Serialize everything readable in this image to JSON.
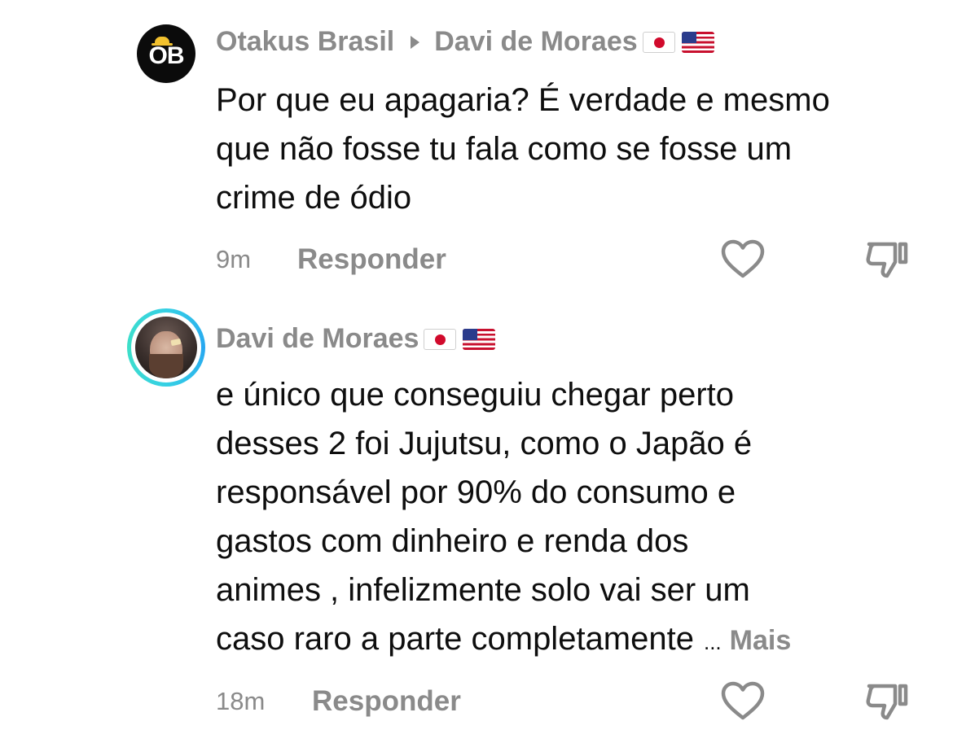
{
  "comments": [
    {
      "author": "Otakus Brasil",
      "reply_to": "Davi de Moraes",
      "text_lines": [
        "Por que eu apagaria? É verdade e mesmo",
        "que não fosse tu fala como se fosse um",
        "crime de ódio"
      ],
      "time": "9m",
      "reply_label": "Responder",
      "avatar_text": "OB"
    },
    {
      "author": "Davi de Moraes",
      "text_lines": [
        "e único que conseguiu chegar perto",
        "desses 2 foi Jujutsu, como o Japão é",
        "responsável por 90% do consumo e",
        "gastos com dinheiro e renda dos",
        "animes , infelizmente solo vai ser um",
        "caso raro a parte completamente"
      ],
      "ellipsis": "...",
      "more_label": "Mais",
      "time": "18m",
      "reply_label": "Responder"
    }
  ],
  "icons": {
    "flags": [
      "japan-flag-icon",
      "us-flag-icon"
    ],
    "actions": [
      "heart-icon",
      "dislike-icon"
    ]
  },
  "colors": {
    "secondary_text": "#8a8a8a",
    "primary_text": "#0e0e0e",
    "story_ring": "#35d0e4"
  }
}
